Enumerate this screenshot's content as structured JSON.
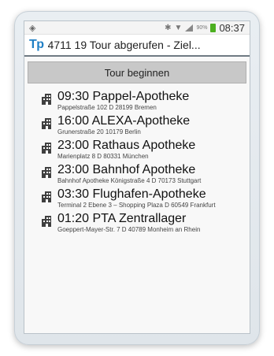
{
  "statusbar": {
    "clock": "08:37",
    "battery_pct": "90%"
  },
  "titlebar": {
    "logo": "Tp",
    "title": "4711 19 Tour abgerufen - Ziel..."
  },
  "actions": {
    "start_tour": "Tour beginnen"
  },
  "stops": [
    {
      "time": "09:30",
      "name": "Pappel-Apotheke",
      "address": "Pappelstraße 102 D 28199 Bremen"
    },
    {
      "time": "16:00",
      "name": "ALEXA-Apotheke",
      "address": "Grunerstraße 20 10179  Berlin"
    },
    {
      "time": "23:00",
      "name": "Rathaus Apotheke",
      "address": "Marienplatz 8 D 80331  München"
    },
    {
      "time": "23:00",
      "name": "Bahnhof Apotheke",
      "address": "Bahnhof Apotheke Königstraße 4 D 70173 Stuttgart"
    },
    {
      "time": "03:30",
      "name": "Flughafen-Apotheke",
      "address": "Terminal 2 Ebene 3 – Shopping Plaza D 60549  Frankfurt"
    },
    {
      "time": "01:20",
      "name": "PTA Zentrallager",
      "address": "Goeppert-Mayer-Str. 7 D 40789 Monheim an Rhein"
    }
  ],
  "icons": {
    "gps": "gps-icon",
    "bluetooth": "bluetooth-icon",
    "wifi": "wifi-icon",
    "signal": "signal-icon",
    "battery": "battery-icon",
    "stop": "building-icon"
  }
}
